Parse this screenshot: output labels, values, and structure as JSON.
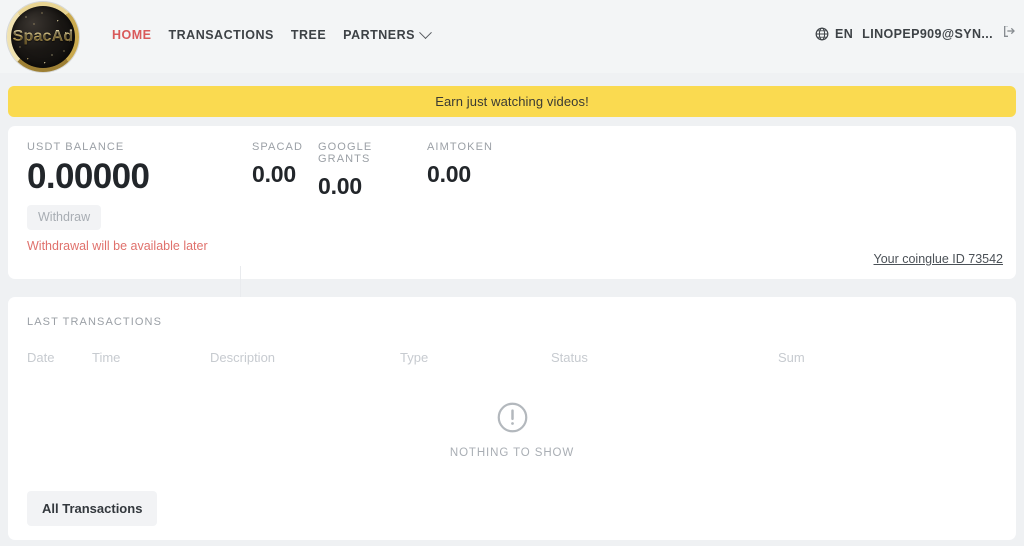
{
  "header": {
    "logo_text": "SpacAd",
    "logo_name": "spacad-logo",
    "nav": [
      {
        "label": "HOME",
        "active": true
      },
      {
        "label": "TRANSACTIONS",
        "active": false
      },
      {
        "label": "TREE",
        "active": false
      },
      {
        "label": "PARTNERS",
        "active": false,
        "has_caret": true
      }
    ],
    "language": {
      "icon": "globe-icon",
      "label": "EN"
    },
    "user_email": "LINOPEP909@SYN...",
    "logout_icon": "logout-icon"
  },
  "banner": {
    "text": "Earn just watching videos!",
    "background": "#fada50"
  },
  "balance_card": {
    "usdt_label": "USDT BALANCE",
    "usdt_amount": "0.00000",
    "withdraw_label": "Withdraw",
    "withdraw_note": "Withdrawal will be available later",
    "tokens": [
      {
        "label": "SPACAD",
        "amount": "0.00"
      },
      {
        "label": "GOOGLE GRANTS",
        "amount": "0.00"
      },
      {
        "label": "AIMTOKEN",
        "amount": "0.00"
      }
    ],
    "coinglue_link": "Your coinglue ID 73542"
  },
  "transactions_card": {
    "title": "LAST TRANSACTIONS",
    "columns": [
      "Date",
      "Time",
      "Description",
      "Type",
      "Status",
      "Sum"
    ],
    "rows": [],
    "empty_icon": "exclamation-circle-icon",
    "empty_text": "NOTHING TO SHOW",
    "all_transactions_label": "All Transactions"
  },
  "colors": {
    "page_background": "#eff1f3",
    "card_background": "#ffffff",
    "accent_yellow": "#fada50",
    "active_link_red": "#d9595a",
    "warning_red": "#e0716c",
    "muted_gray": "#9ba0a6"
  }
}
